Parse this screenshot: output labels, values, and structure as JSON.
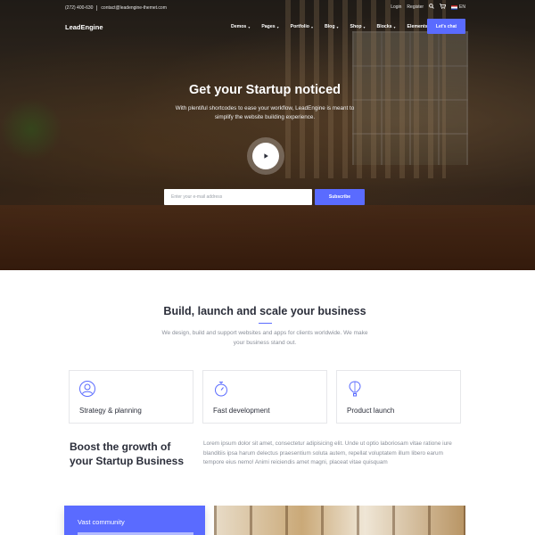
{
  "topbar": {
    "phone": "(272) 400-630",
    "email": "contact@leadengine-themet.com",
    "login": "Login",
    "register": "Register",
    "language": "EN",
    "icons": [
      "search-icon",
      "cart-icon",
      "flag-icon"
    ]
  },
  "nav": {
    "logo": "LeadEngine",
    "items": [
      {
        "label": "Demos"
      },
      {
        "label": "Pages"
      },
      {
        "label": "Portfolio"
      },
      {
        "label": "Blog"
      },
      {
        "label": "Shop"
      },
      {
        "label": "Blocks"
      },
      {
        "label": "Elements"
      }
    ],
    "cta": "Let's chat"
  },
  "hero": {
    "title": "Get your Startup noticed",
    "subtitle": "With plentiful shortcodes to ease your workflow, LeadEngine is meant to simplify the website building experience.",
    "email_placeholder": "Enter your e-mail address",
    "subscribe": "Subscribe"
  },
  "intro": {
    "title": "Build, launch and scale your business",
    "text": "We design, build and support websites and apps for clients worldwide. We make your business stand out."
  },
  "features": [
    {
      "label": "Strategy & planning",
      "icon": "user-circle-icon"
    },
    {
      "label": "Fast development",
      "icon": "stopwatch-icon"
    },
    {
      "label": "Product launch",
      "icon": "hot-air-balloon-icon"
    }
  ],
  "boost": {
    "title": "Boost the growth of your Startup Business",
    "text": "Lorem ipsum dolor sit amet, consectetur adipisicing elit. Unde ut optio laboriosam vitae ratione iure blanditiis ipsa harum delectus praesentium soluta autem, repellat voluptatem illum libero earum tempore eius nemo! Animi reiciendis amet magni, placeat vitae quisquam"
  },
  "community": {
    "title": "Vast community"
  },
  "colors": {
    "accent": "#5a6bff",
    "text": "#2b2e3a",
    "muted": "#8a8f99"
  }
}
